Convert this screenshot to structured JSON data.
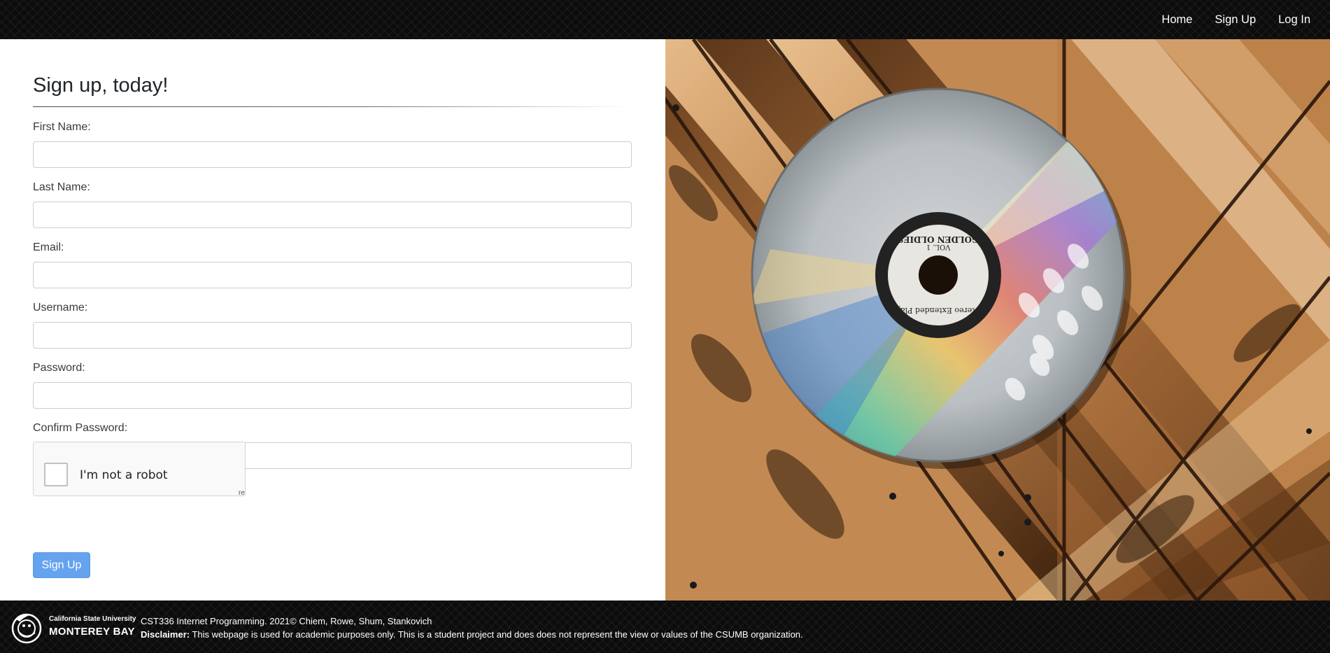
{
  "nav": {
    "items": [
      {
        "label": "Home"
      },
      {
        "label": "Sign Up"
      },
      {
        "label": "Log In"
      }
    ]
  },
  "form": {
    "title": "Sign up, today!",
    "fields": [
      {
        "label": "First Name:",
        "value": "",
        "placeholder": ""
      },
      {
        "label": "Last Name:",
        "value": "",
        "placeholder": ""
      },
      {
        "label": "Email:",
        "value": "",
        "placeholder": ""
      },
      {
        "label": "Username:",
        "value": "",
        "placeholder": ""
      },
      {
        "label": "Password:",
        "value": "",
        "placeholder": ""
      },
      {
        "label": "Confirm Password:",
        "value": "",
        "placeholder": ""
      }
    ],
    "captcha": {
      "label": "I'm not a robot",
      "logo_text": "re"
    },
    "submit_label": "Sign Up"
  },
  "photo": {
    "label_text_1": "Stereo Extended Play",
    "label_text_2": "GOLDEN OLDIES",
    "label_text_3": "VOL. 1"
  },
  "footer": {
    "logo_line_1": "California State University",
    "logo_line_2": "MONTEREY BAY",
    "course_line": "CST336 Internet Programming. 2021© Chiem, Rowe, Shum, Stankovich",
    "disclaimer_label": "Disclaimer:",
    "disclaimer_text": " This webpage is used for academic purposes only. This is a student project and does does not represent the view or values of the CSUMB organization."
  },
  "colors": {
    "nav_bg": "#0c0c0c",
    "button_bg": "#65a3ee",
    "wood": "#b7834e"
  }
}
